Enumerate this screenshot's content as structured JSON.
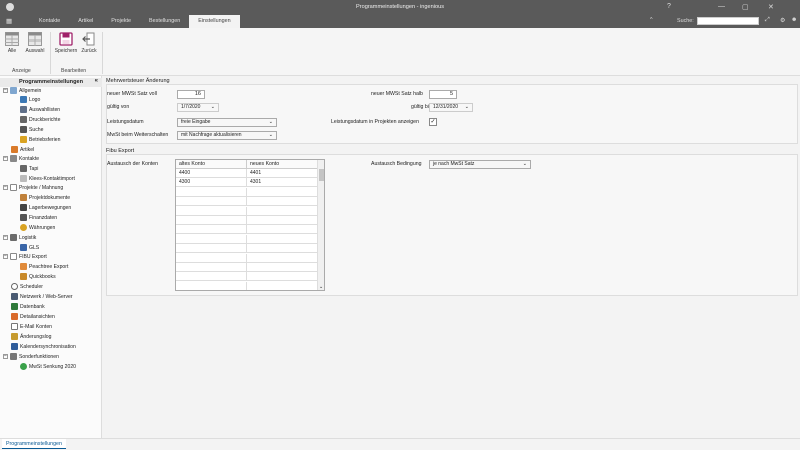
{
  "window": {
    "title": "Programmeinstellungen - ingenious"
  },
  "tabs": [
    "Kontakte",
    "Artikel",
    "Projekte",
    "Bestellungen",
    "Einstellungen"
  ],
  "search": {
    "label": "Suche:"
  },
  "ribbon": {
    "groups": [
      {
        "label": "Anzeige",
        "buttons": [
          "Alle",
          "Auswahl"
        ]
      },
      {
        "label": "Bearbeiten",
        "buttons": [
          "Speichern",
          "Zurück"
        ]
      }
    ]
  },
  "sidebar": {
    "title": "Programmeinstellungen",
    "collapse": "«",
    "items": [
      "Allgemein",
      "Logo",
      "Auswahllisten",
      "Druckberichte",
      "Suche",
      "Betriebsferien",
      "Artikel",
      "Kontakte",
      "Tapi",
      "Klees-Kontaktimport",
      "Projekte / Mahnung",
      "Projektdokumente",
      "Lagerbewegungen",
      "Finanzdaten",
      "Währungen",
      "Logistik",
      "GLS",
      "FIBU Export",
      "Peachtree Export",
      "Quickbooks",
      "Scheduler",
      "Netzwerk / Web-Server",
      "Datenbank",
      "Detailansichten",
      "E-Mail Konten",
      "Änderungslog",
      "Kalendersynchronisation",
      "Sonderfunktionen",
      "MwSt Senkung 2020"
    ]
  },
  "mwst": {
    "title": "Mehrwertsteuer Änderung",
    "voll_label": "neuer MWSt Satz voll",
    "voll_value": "16",
    "halb_label": "neuer MWSt Satz halb",
    "halb_value": "5",
    "gueltig_von_label": "gültig von",
    "gueltig_von_value": "1/7/2020",
    "gueltig_bis_label": "gültig bis",
    "gueltig_bis_value": "12/31/2020",
    "leistungsdatum_label": "Leistungsdatum",
    "leistungsdatum_value": "freie Eingabe",
    "leistung_projekte_label": "Leistungsdatum in Projekten anzeigen",
    "weiterschalten_label": "MwSt beim Weiterschalten",
    "weiterschalten_value": "mit Nachfrage aktualisieren"
  },
  "fibu": {
    "title": "Fibu Export",
    "konten_label": "Austausch der Konten",
    "headers": [
      "altes Konto",
      "neues Konto"
    ],
    "rows": [
      [
        "4400",
        "4401"
      ],
      [
        "4300",
        "4301"
      ]
    ],
    "bedingung_label": "Austausch Bedingung",
    "bedingung_value": "je nach MwSt Satz"
  },
  "status": {
    "tab": "Programmeinstellungen"
  }
}
